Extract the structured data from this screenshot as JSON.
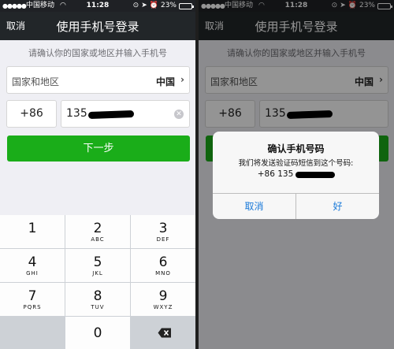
{
  "status_bar": {
    "signal": "●●●●●",
    "carrier": "中国移动",
    "wifi_icon": "wifi-icon",
    "time": "11:28",
    "battery": "23%",
    "battery_level": 0.23
  },
  "nav": {
    "cancel_label": "取消",
    "title": "使用手机号登录"
  },
  "prompt": "请确认你的国家或地区并输入手机号",
  "region": {
    "label": "国家和地区",
    "value": "中国"
  },
  "phone": {
    "country_code": "+86",
    "number_prefix": "135"
  },
  "next_label": "下一步",
  "keypad": {
    "keys": [
      {
        "digit": "1",
        "letters": ""
      },
      {
        "digit": "2",
        "letters": "ABC"
      },
      {
        "digit": "3",
        "letters": "DEF"
      },
      {
        "digit": "4",
        "letters": "GHI"
      },
      {
        "digit": "5",
        "letters": "JKL"
      },
      {
        "digit": "6",
        "letters": "MNO"
      },
      {
        "digit": "7",
        "letters": "PQRS"
      },
      {
        "digit": "8",
        "letters": "TUV"
      },
      {
        "digit": "9",
        "letters": "WXYZ"
      },
      {
        "digit": "0",
        "letters": ""
      }
    ]
  },
  "alert": {
    "title": "确认手机号码",
    "message": "我们将发送验证码短信到这个号码:",
    "number": "+86 135",
    "cancel_label": "取消",
    "ok_label": "好"
  },
  "colors": {
    "accent_green": "#1aad19",
    "nav_bg": "#222629",
    "link_blue": "#1a7ad9"
  }
}
